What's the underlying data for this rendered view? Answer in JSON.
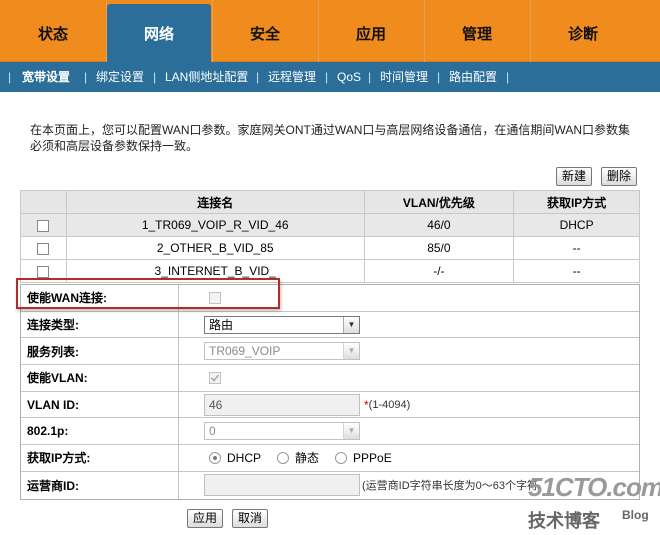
{
  "topnav": {
    "tabs": [
      {
        "label": "状态"
      },
      {
        "label": "网络",
        "active": true
      },
      {
        "label": "安全"
      },
      {
        "label": "应用"
      },
      {
        "label": "管理"
      },
      {
        "label": "诊断"
      }
    ]
  },
  "subnav": {
    "items": [
      {
        "label": "宽带设置",
        "active": true
      },
      {
        "label": "绑定设置"
      },
      {
        "label": "LAN侧地址配置"
      },
      {
        "label": "远程管理"
      },
      {
        "label": "QoS"
      },
      {
        "label": "时间管理"
      },
      {
        "label": "路由配置"
      }
    ],
    "separator": "|"
  },
  "description": "在本页面上，您可以配置WAN口参数。家庭网关ONT通过WAN口与高层网络设备通信，在通信期间WAN口参数集必须和高层设备参数保持一致。",
  "actions": {
    "new_label": "新建",
    "delete_label": "删除"
  },
  "wan_table": {
    "headers": [
      "",
      "连接名",
      "VLAN/优先级",
      "获取IP方式"
    ],
    "rows": [
      {
        "name": "1_TR069_VOIP_R_VID_46",
        "vlan": "46/0",
        "ip_mode": "DHCP"
      },
      {
        "name": "2_OTHER_B_VID_85",
        "vlan": "85/0",
        "ip_mode": "--"
      },
      {
        "name": "3_INTERNET_B_VID_",
        "vlan": "-/-",
        "ip_mode": "--"
      }
    ]
  },
  "form": {
    "enable_wan": {
      "label": "使能WAN连接:",
      "checked": false
    },
    "connection_type": {
      "label": "连接类型:",
      "value": "路由"
    },
    "service_list": {
      "label": "服务列表:",
      "value": "TR069_VOIP"
    },
    "enable_vlan": {
      "label": "使能VLAN:",
      "checked": true
    },
    "vlan_id": {
      "label": "VLAN ID:",
      "value": "46",
      "required_mark": "*",
      "hint": "(1-4094)"
    },
    "priority": {
      "label": "802.1p:",
      "value": "0"
    },
    "ip_mode": {
      "label": "获取IP方式:",
      "options": [
        "DHCP",
        "静态",
        "PPPoE"
      ],
      "selected": "DHCP"
    },
    "isp_id": {
      "label": "运营商ID:",
      "value": "",
      "hint": "(运营商ID字符串长度为0～63个字符"
    }
  },
  "footer": {
    "apply_label": "应用",
    "cancel_label": "取消"
  },
  "watermark": {
    "main": "51CTO.com",
    "sub": "技术博客",
    "blog": "Blog"
  },
  "colors": {
    "nav_orange": "#f08c1e",
    "nav_blue": "#2b6e99",
    "highlight_red": "#b52a2a",
    "required_red": "#d00000"
  }
}
